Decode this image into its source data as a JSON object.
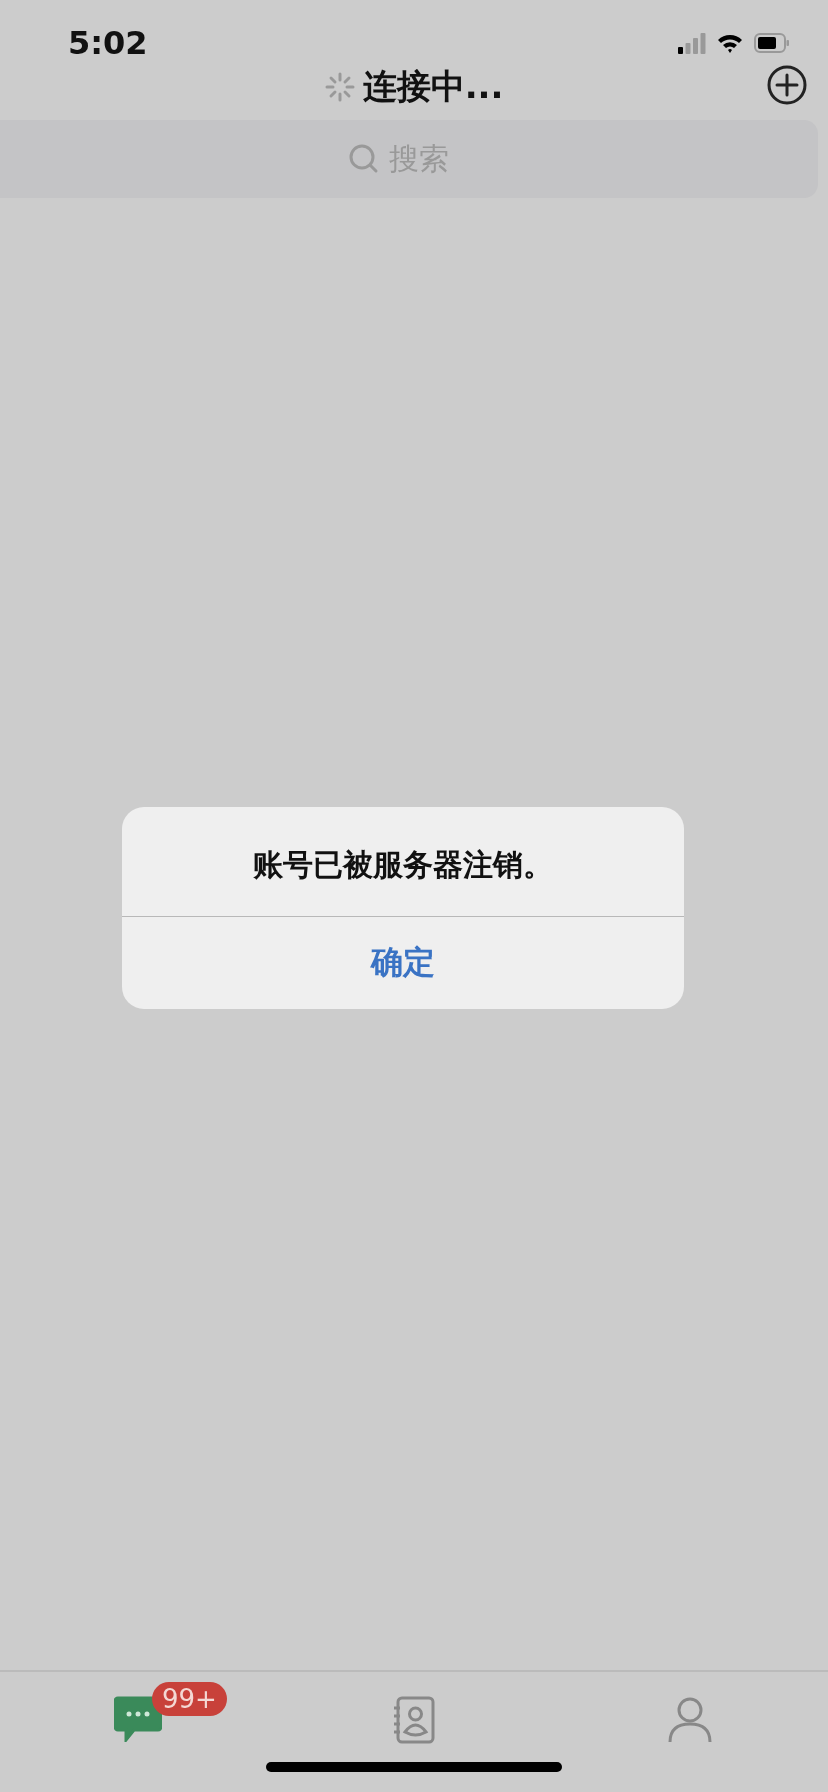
{
  "status_bar": {
    "time": "5:02"
  },
  "nav": {
    "title": "连接中...",
    "loading": true
  },
  "search": {
    "placeholder": "搜索"
  },
  "alert": {
    "message": "账号已被服务器注销。",
    "button": "确定"
  },
  "tabs": [
    {
      "kind": "chats",
      "selected": true,
      "badge": "99+"
    },
    {
      "kind": "contacts",
      "selected": false
    },
    {
      "kind": "me",
      "selected": false
    }
  ]
}
